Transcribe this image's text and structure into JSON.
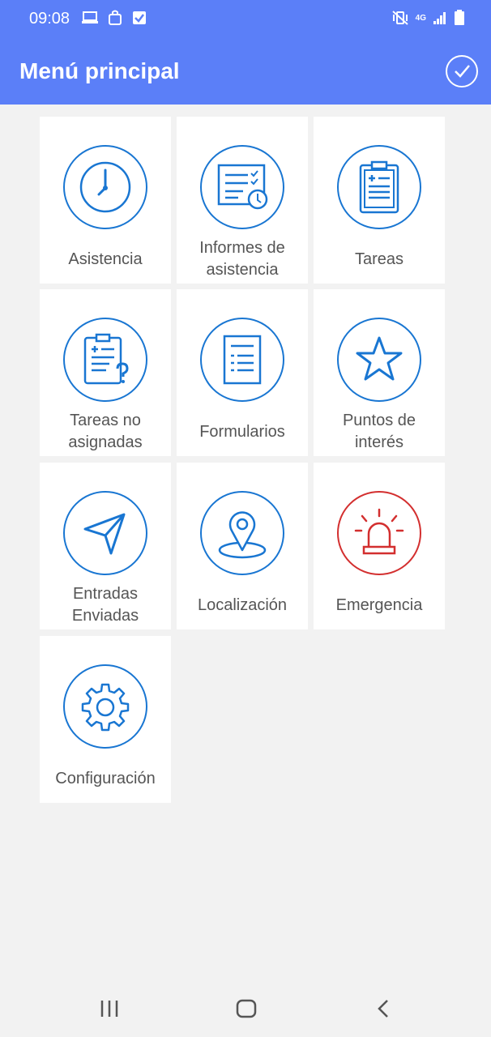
{
  "status_bar": {
    "time": "09:08",
    "network": "4G",
    "left_icons": [
      "laptop-icon",
      "shopping-bag-icon",
      "checkbox-icon"
    ],
    "right_icons": [
      "vibrate-mute-icon",
      "network-4g-icon",
      "signal-icon",
      "battery-icon"
    ]
  },
  "header": {
    "title": "Menú principal",
    "action_icon": "check-circle-icon"
  },
  "menu": {
    "items": [
      {
        "label": "Asistencia",
        "icon": "clock-icon",
        "color": "#1976d2"
      },
      {
        "label": "Informes de\nasistencia",
        "icon": "report-clock-icon",
        "color": "#1976d2"
      },
      {
        "label": "Tareas",
        "icon": "clipboard-icon",
        "color": "#1976d2"
      },
      {
        "label": "Tareas no\nasignadas",
        "icon": "clipboard-question-icon",
        "color": "#1976d2"
      },
      {
        "label": "Formularios",
        "icon": "form-icon",
        "color": "#1976d2"
      },
      {
        "label": "Puntos de\ninterés",
        "icon": "star-icon",
        "color": "#1976d2"
      },
      {
        "label": "Entradas\nEnviadas",
        "icon": "paper-plane-icon",
        "color": "#1976d2"
      },
      {
        "label": "Localización",
        "icon": "location-pin-icon",
        "color": "#1976d2"
      },
      {
        "label": "Emergencia",
        "icon": "siren-icon",
        "color": "#d32f2f"
      },
      {
        "label": "Configuración",
        "icon": "gear-icon",
        "color": "#1976d2"
      }
    ]
  },
  "nav_bar": {
    "icons": [
      "recent-apps-icon",
      "home-icon",
      "back-icon"
    ]
  },
  "colors": {
    "header_bg": "#5b7ff8",
    "page_bg": "#f2f2f2",
    "icon_blue": "#1976d2",
    "icon_red": "#d32f2f",
    "label_gray": "#555555"
  }
}
